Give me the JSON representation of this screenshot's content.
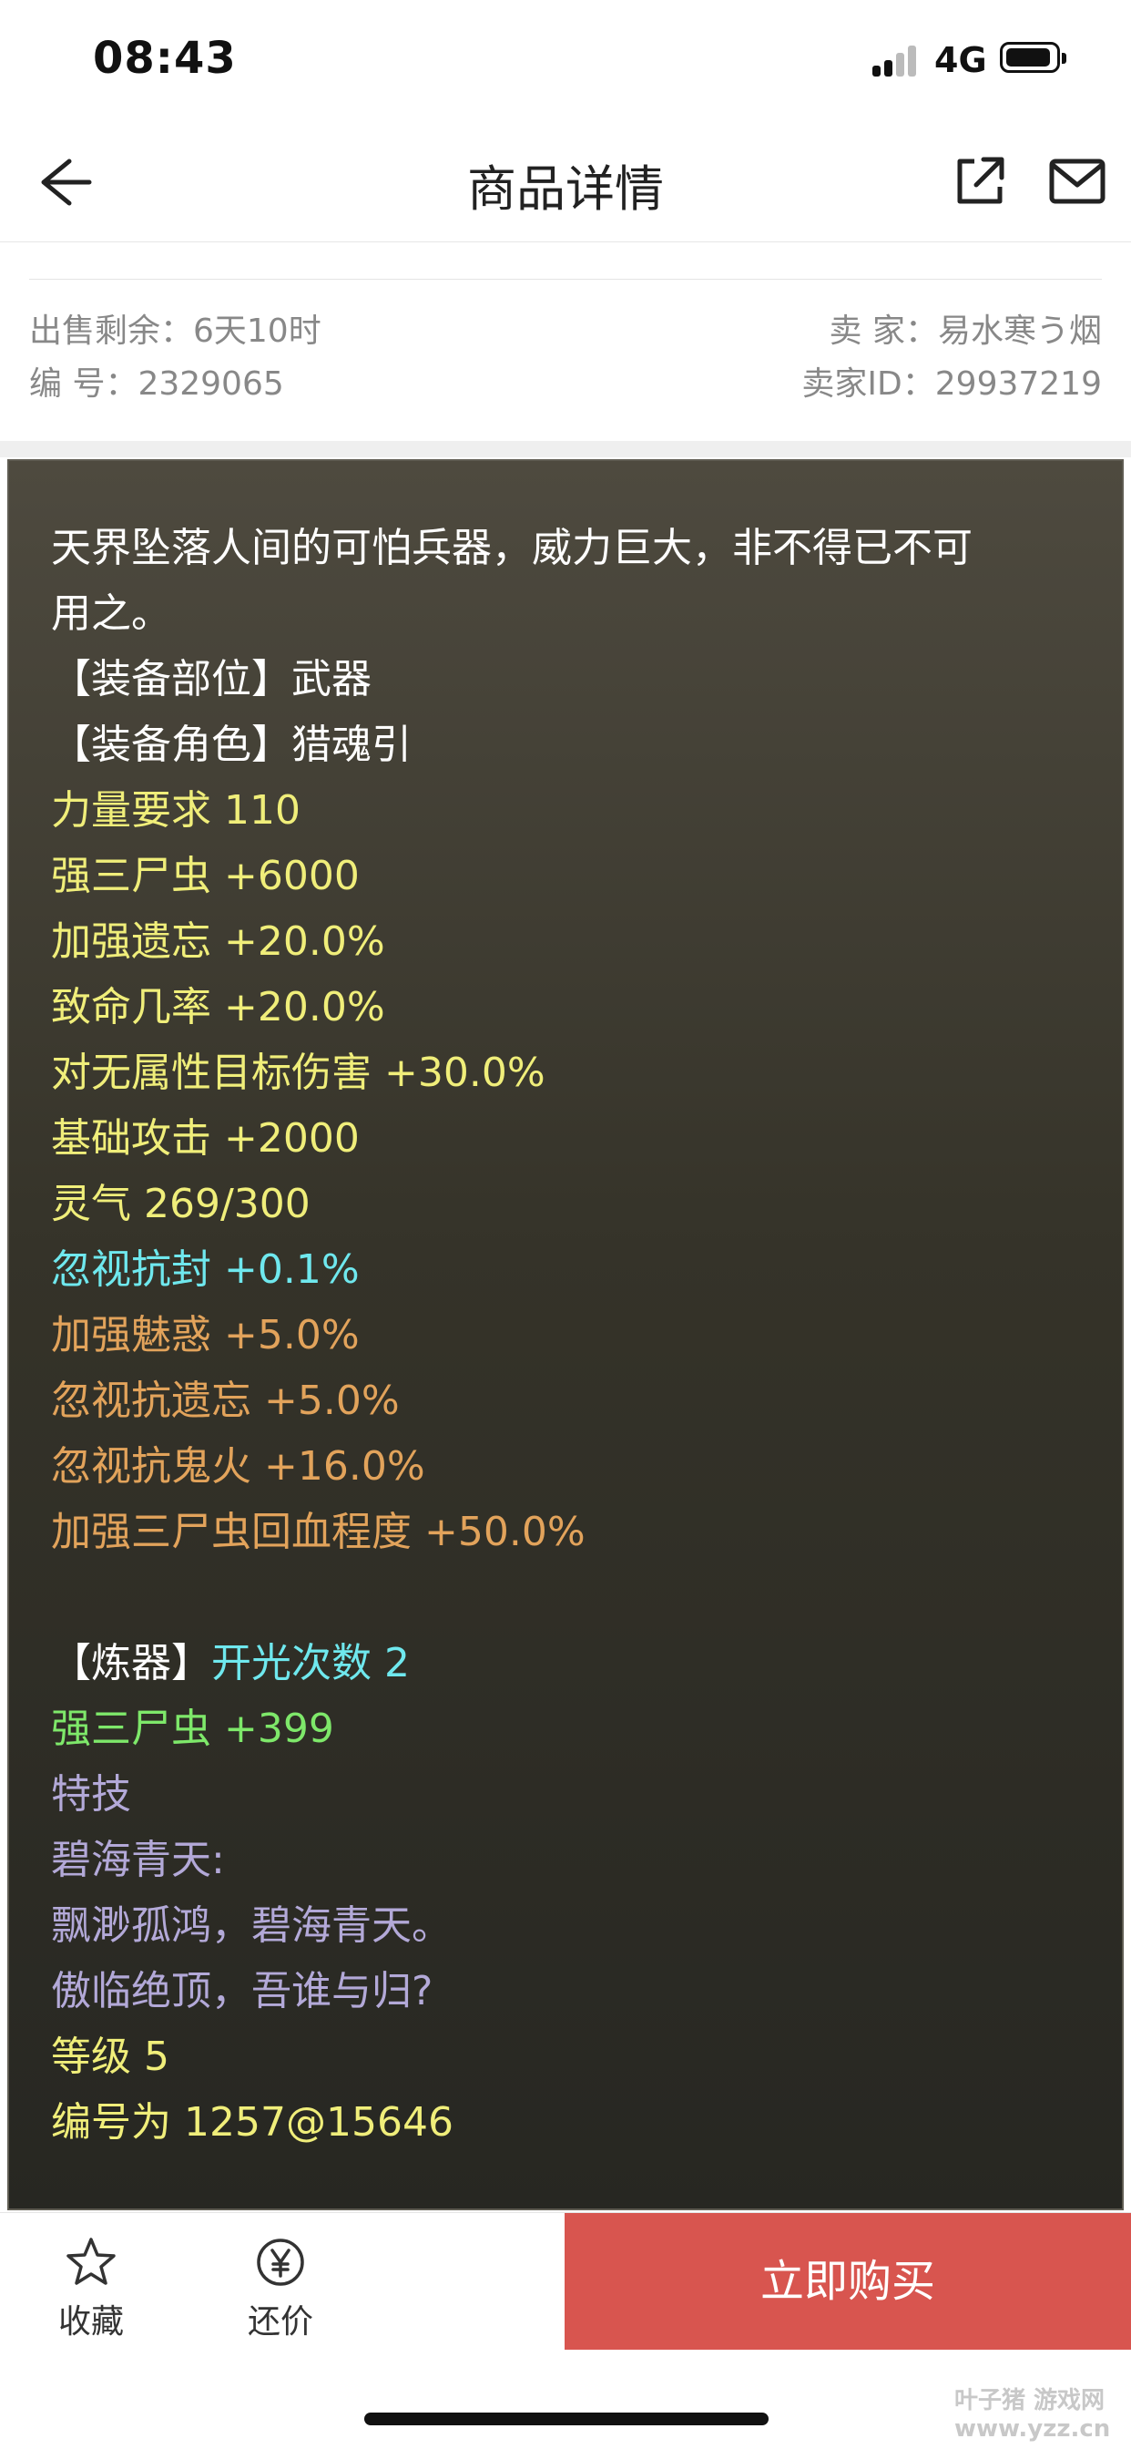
{
  "status_bar": {
    "time": "08:43",
    "network": "4G"
  },
  "nav": {
    "title": "商品详情"
  },
  "info": {
    "remaining": "出售剩余：6天10时",
    "serial": "编 号：2329065",
    "seller": "卖 家：易水寒う烟",
    "seller_id": "卖家ID：29937219"
  },
  "item_lines": [
    {
      "text": "天界坠落人间的可怕兵器，威力巨大，非不得已不可",
      "color": "white"
    },
    {
      "text": "用之。",
      "color": "white"
    },
    {
      "text": "【装备部位】武器",
      "color": "white"
    },
    {
      "text": "【装备角色】猎魂引",
      "color": "white"
    },
    {
      "text": "力量要求 110",
      "color": "yellow"
    },
    {
      "text": "强三尸虫 +6000",
      "color": "yellow"
    },
    {
      "text": "加强遗忘 +20.0%",
      "color": "yellow"
    },
    {
      "text": "致命几率 +20.0%",
      "color": "yellow"
    },
    {
      "text": "对无属性目标伤害 +30.0%",
      "color": "yellow"
    },
    {
      "text": "基础攻击 +2000",
      "color": "yellow"
    },
    {
      "text": "灵气 269/300",
      "color": "yellow"
    },
    {
      "text": "忽视抗封 +0.1%",
      "color": "cyan"
    },
    {
      "text": "加强魅惑 +5.0%",
      "color": "orange"
    },
    {
      "text": "忽视抗遗忘 +5.0%",
      "color": "orange"
    },
    {
      "text": "忽视抗鬼火 +16.0%",
      "color": "orange"
    },
    {
      "text": "加强三尸虫回血程度 +50.0%",
      "color": "orange"
    },
    {
      "text": "",
      "color": "white"
    },
    {
      "text_prefix": "【炼器】",
      "text_suffix": "开光次数 2",
      "color": "white",
      "suffix_color": "cyan"
    },
    {
      "text": "强三尸虫 +399",
      "color": "green"
    },
    {
      "text": "特技",
      "color": "lavender"
    },
    {
      "text": "碧海青天:",
      "color": "lavender"
    },
    {
      "text": "飘渺孤鸿，碧海青天。",
      "color": "lavender"
    },
    {
      "text": "傲临绝顶，吾谁与归?",
      "color": "lavender"
    },
    {
      "text": "等级 5",
      "color": "yellow"
    },
    {
      "text": "编号为 1257@15646",
      "color": "yellow"
    }
  ],
  "bottom": {
    "favorite_label": "收藏",
    "bargain_label": "还价",
    "buy_label": "立即购买"
  },
  "watermark": "叶子猪 游戏网 www.yzz.cn",
  "colors": {
    "buy_button": "#d8554f",
    "panel_bg": "#353329"
  }
}
